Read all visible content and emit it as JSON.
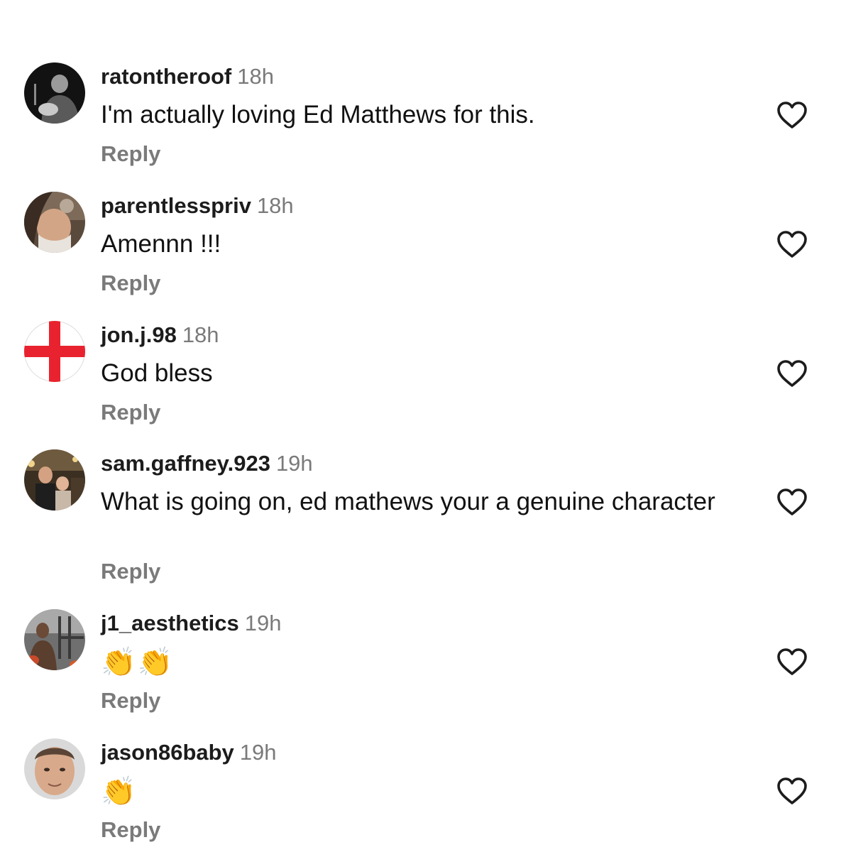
{
  "comments": [
    {
      "username": "ratontheroof",
      "time": "18h",
      "text": "I'm actually loving Ed Matthews for this.",
      "reply": "Reply",
      "avatar": "guitarist-photo"
    },
    {
      "username": "parentlesspriv",
      "time": "18h",
      "text": "Amennn !!!",
      "reply": "Reply",
      "avatar": "person-photo"
    },
    {
      "username": "jon.j.98",
      "time": "18h",
      "text": "God bless",
      "reply": "Reply",
      "avatar": "st-george-cross-flag"
    },
    {
      "username": "sam.gaffney.923",
      "time": "19h",
      "text": "What is going on, ed mathews your a genuine character",
      "reply": "Reply",
      "avatar": "family-photo"
    },
    {
      "username": "j1_aesthetics",
      "time": "19h",
      "text": "👏👏",
      "reply": "Reply",
      "avatar": "gym-photo"
    },
    {
      "username": "jason86baby",
      "time": "19h",
      "text": "👏",
      "reply": "Reply",
      "avatar": "face-photo"
    }
  ],
  "colors": {
    "text": "#111111",
    "secondary": "#7a7a7a",
    "heart_outline": "#1c1c1c",
    "flag_red": "#e8232f"
  },
  "icons": {
    "like": "heart-outline-icon"
  }
}
